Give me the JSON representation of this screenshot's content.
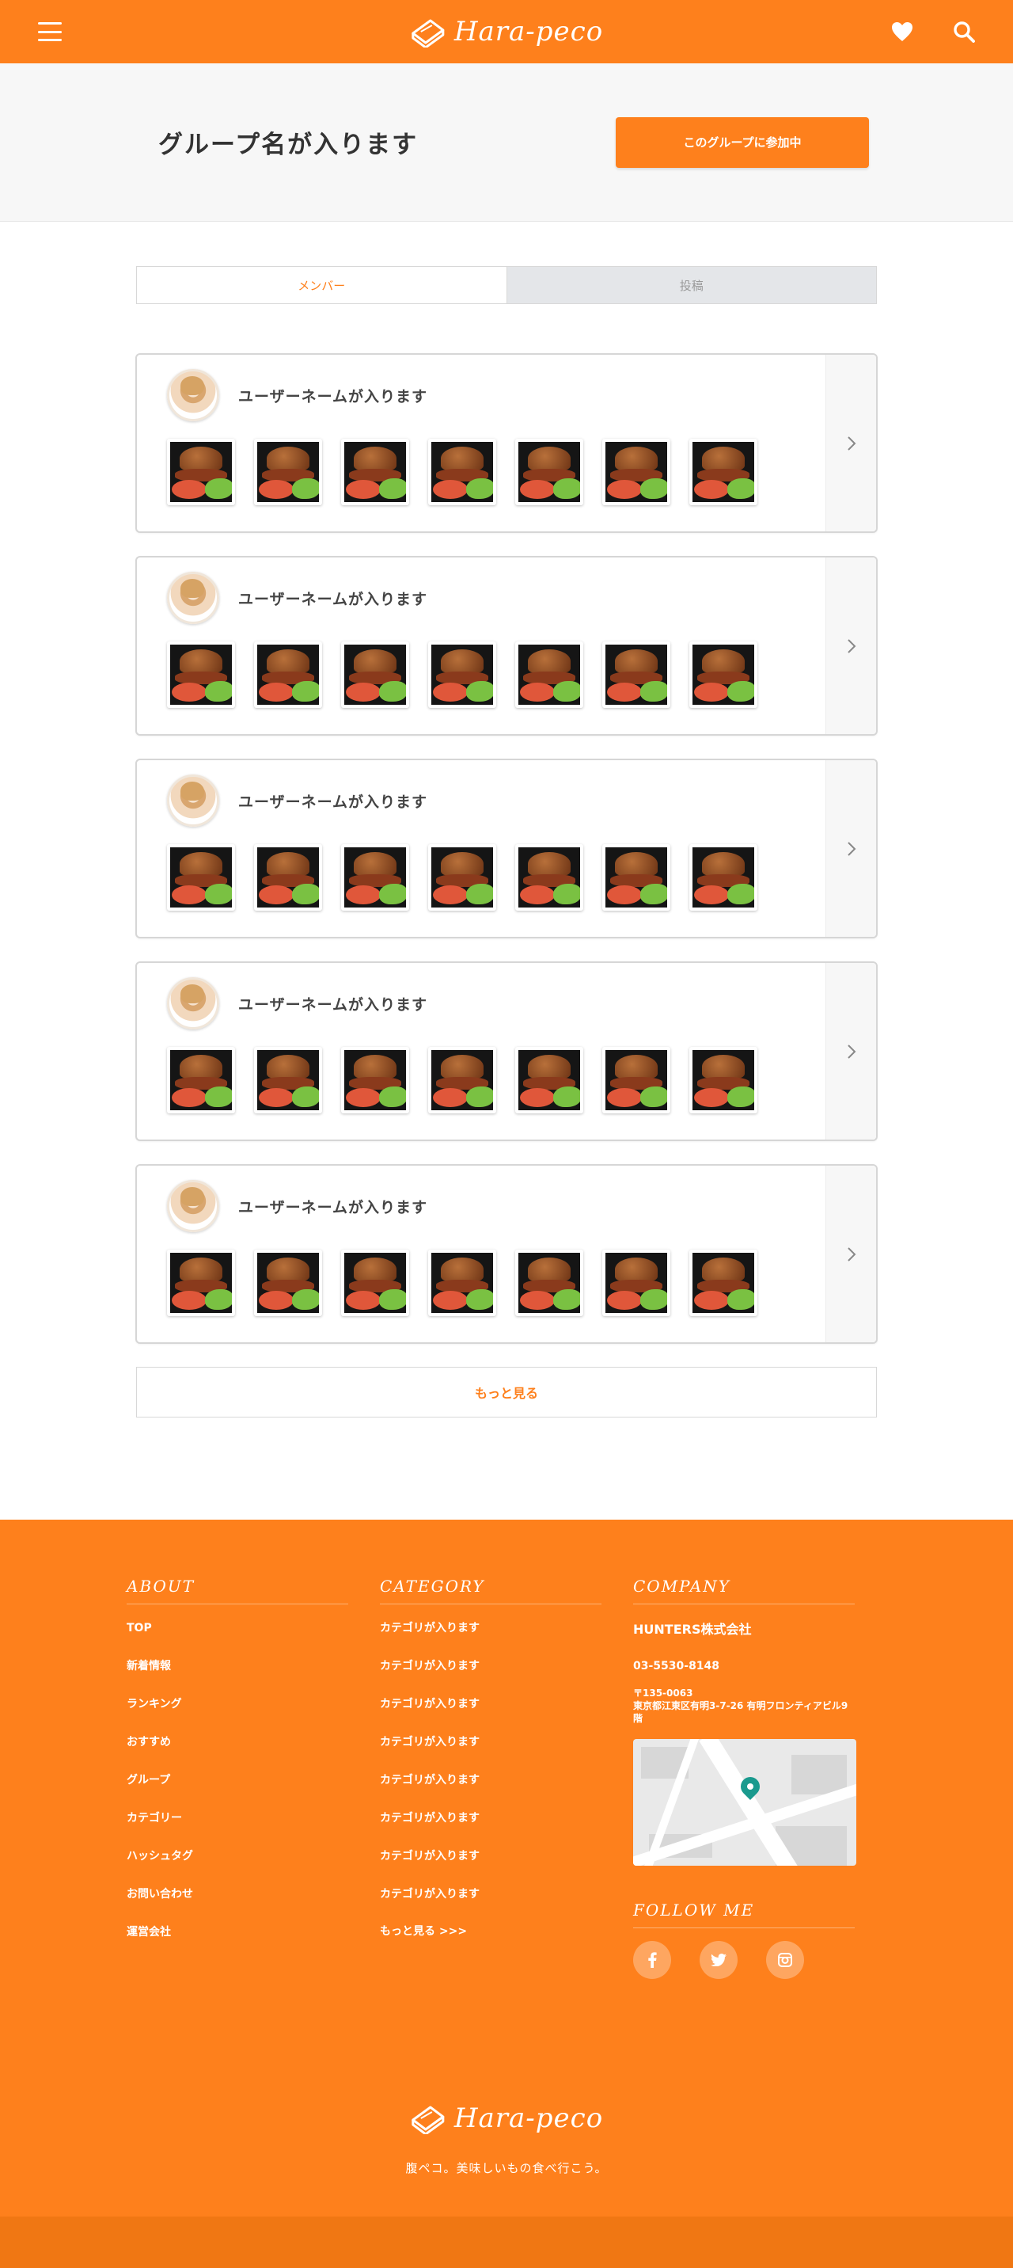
{
  "header": {
    "logo_text": "Hara-peco",
    "menu_icon": "hamburger-menu-icon",
    "favorite_icon": "heart-icon",
    "search_icon": "search-icon",
    "brand_color": "#fe801c"
  },
  "group": {
    "title": "グループ名が入ります",
    "join_label": "このグループに参加中"
  },
  "tabs": [
    {
      "label": "メンバー",
      "active": true
    },
    {
      "label": "投稿",
      "active": false
    }
  ],
  "members": [
    {
      "name": "ユーザーネームが入ります"
    },
    {
      "name": "ユーザーネームが入ります"
    },
    {
      "name": "ユーザーネームが入ります"
    },
    {
      "name": "ユーザーネームが入ります"
    },
    {
      "name": "ユーザーネームが入ります"
    }
  ],
  "more_label": "もっと見る",
  "footer": {
    "about": {
      "heading": "ABOUT",
      "items": [
        "TOP",
        "新着情報",
        "ランキング",
        "おすすめ",
        "グループ",
        "カテゴリー",
        "ハッシュタグ",
        "お問い合わせ",
        "運営会社"
      ]
    },
    "category": {
      "heading": "CATEGORY",
      "items": [
        "カテゴリが入ります",
        "カテゴリが入ります",
        "カテゴリが入ります",
        "カテゴリが入ります",
        "カテゴリが入ります",
        "カテゴリが入ります",
        "カテゴリが入ります",
        "カテゴリが入ります"
      ],
      "more": "もっと見る >>>"
    },
    "company": {
      "heading": "COMPANY",
      "name": "HUNTERS株式会社",
      "tel": "03-5530-8148",
      "postal": "〒135-0063",
      "address": "東京都江東区有明3-7-26 有明フロンティアビル9階"
    },
    "follow": {
      "heading": "FOLLOW ME",
      "icons": [
        "facebook-icon",
        "twitter-icon",
        "instagram-icon"
      ]
    },
    "logo_text": "Hara-peco",
    "tagline": "腹ペコ。美味しいもの食べ行こう。"
  }
}
